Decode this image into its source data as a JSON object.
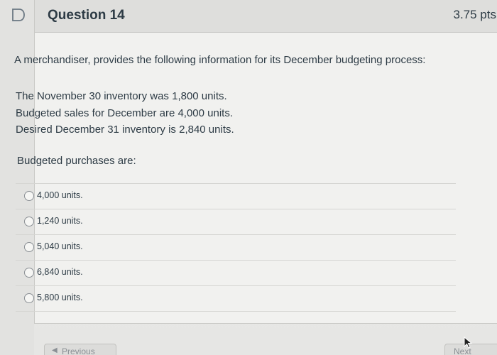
{
  "question": {
    "title": "Question 14",
    "points": "3.75 pts",
    "prompt": "A merchandiser, provides the following information for its December budgeting process:",
    "facts": [
      "The November 30 inventory was 1,800 units.",
      "Budgeted sales for December are 4,000 units.",
      "Desired December 31 inventory is 2,840 units."
    ],
    "ask": "Budgeted purchases are:",
    "answers": [
      "4,000 units.",
      "1,240 units.",
      "5,040 units.",
      "6,840 units.",
      "5,800 units."
    ]
  },
  "nav": {
    "previous_label": "Previous",
    "next_label": "Next"
  },
  "icons": {
    "flag": "flag-icon",
    "previous_arrow": "triangle-left-icon",
    "cursor": "mouse-pointer-icon"
  },
  "colors": {
    "text": "#2d3b45",
    "header_bg": "#dededc",
    "card_bg": "#f1f1ef",
    "divider": "#d5d5d2"
  }
}
